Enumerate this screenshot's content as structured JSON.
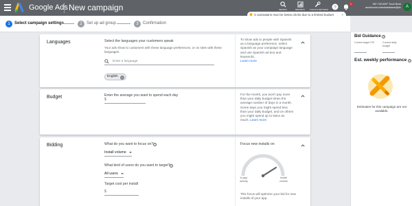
{
  "header": {
    "app_title": "Google Ads",
    "page_title": "New campaign",
    "tools": [
      {
        "label": "SEARCH",
        "icon": "search-icon"
      },
      {
        "label": "REPORTS",
        "icon": "reports-icon"
      },
      {
        "label": "TOOLS & SETTINGS",
        "icon": "wrench-icon"
      }
    ],
    "notification_count": "1",
    "account_line1": "087-745-5497 Truck Book",
    "account_line2": "anonkumar.chandrasekaran@dci...",
    "avatar_initial": "A"
  },
  "notice": {
    "text": "3 campaigns may be losing clicks due to a limited budget",
    "close": "×"
  },
  "stepper": {
    "steps": [
      {
        "number": "1",
        "label": "Select campaign settings"
      },
      {
        "number": "2",
        "label": "Set up ad group"
      },
      {
        "number": "3",
        "label": "Confirmation"
      }
    ]
  },
  "languages": {
    "title": "Languages",
    "prompt": "Select the languages your customers speak",
    "description": "Your ads show to customers with these language preferences, or on sites with these languages.",
    "search_placeholder": "Enter a language",
    "selected": [
      "English"
    ],
    "help": "To show ads to people with Spanish as a language preference, select Spanish as your campaign language and use Spanish ad text and keywords.",
    "learn_more": "Learn more"
  },
  "budget": {
    "title": "Budget",
    "prompt": "Enter the average you want to spend each day",
    "currency": "$",
    "help": "For the month, you won't pay more than your daily budget times the average number of days in a month. Some days you might spend less than your daily budget, and on others you might spend up to twice as much.",
    "learn_more": "Learn more"
  },
  "bidding": {
    "title": "Bidding",
    "focus_question": "What do you want to focus on?",
    "focus_value": "Install volume",
    "users_question": "What kind of users do you want to target?",
    "users_value": "All users",
    "target_cost_label": "Target cost per install",
    "target_currency": "$",
    "panel_title": "Focus new installs on",
    "gauge_left": "In-app activity",
    "gauge_right": "Install volume",
    "panel_text": "This focus will optimize your bid for new installs of your app."
  },
  "side": {
    "bid_guidance_title": "Bid Guidance",
    "current_target": "Current target CPI",
    "current_budget": "Current daily budget",
    "est_title": "Est. weekly performance",
    "est_text": "Estimates for this campaign are not available."
  },
  "colors": {
    "topbar": "#5f6368",
    "accent": "#1a73e8",
    "step_inactive": "#9aa0a6"
  }
}
